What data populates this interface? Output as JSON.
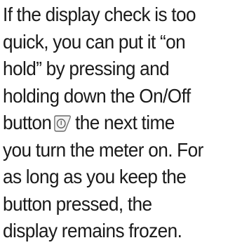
{
  "paragraph": {
    "lines": [
      "If the display check is too",
      "quick, you can put it “on",
      "hold” by pressing and",
      "holding down the On/Off",
      "button",
      "the next time",
      "you turn the meter on. For",
      "as long as you keep the",
      "button pressed, the",
      "display remains frozen."
    ]
  },
  "icons": {
    "onoff_button": "power-button-icon"
  }
}
